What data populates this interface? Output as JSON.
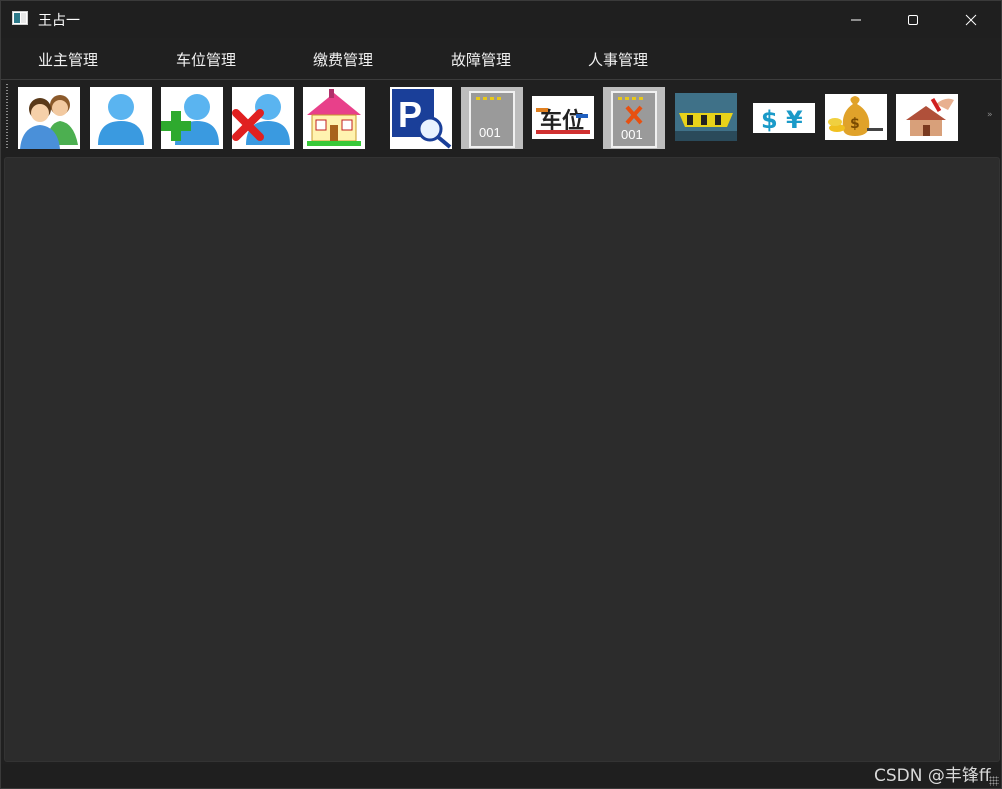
{
  "window": {
    "title": "王占一"
  },
  "menubar": {
    "items": [
      {
        "label": "业主管理"
      },
      {
        "label": "车位管理"
      },
      {
        "label": "缴费管理"
      },
      {
        "label": "故障管理"
      },
      {
        "label": "人事管理"
      }
    ]
  },
  "toolbar": {
    "tools": [
      {
        "icon": "owners-icon",
        "text": ""
      },
      {
        "icon": "user-icon",
        "text": ""
      },
      {
        "icon": "add-user-icon",
        "text": ""
      },
      {
        "icon": "delete-user-icon",
        "text": ""
      },
      {
        "icon": "house-icon",
        "text": ""
      },
      {
        "icon": "parking-search-icon",
        "text": "P"
      },
      {
        "icon": "parking-space-icon",
        "text": "001"
      },
      {
        "icon": "parking-logo-icon",
        "text": "车位"
      },
      {
        "icon": "parking-space-delete-icon",
        "text": "001"
      },
      {
        "icon": "parking-barrier-icon",
        "text": ""
      },
      {
        "icon": "currency-icon",
        "text": "$ ¥"
      },
      {
        "icon": "money-bag-icon",
        "text": "$"
      },
      {
        "icon": "house-repair-icon",
        "text": ""
      }
    ]
  },
  "watermark": {
    "text": "CSDN @丰锋ff"
  },
  "colors": {
    "titlebar_bg": "#1f1f1f",
    "central_bg": "#2c2c2c",
    "text": "#ffffff"
  }
}
